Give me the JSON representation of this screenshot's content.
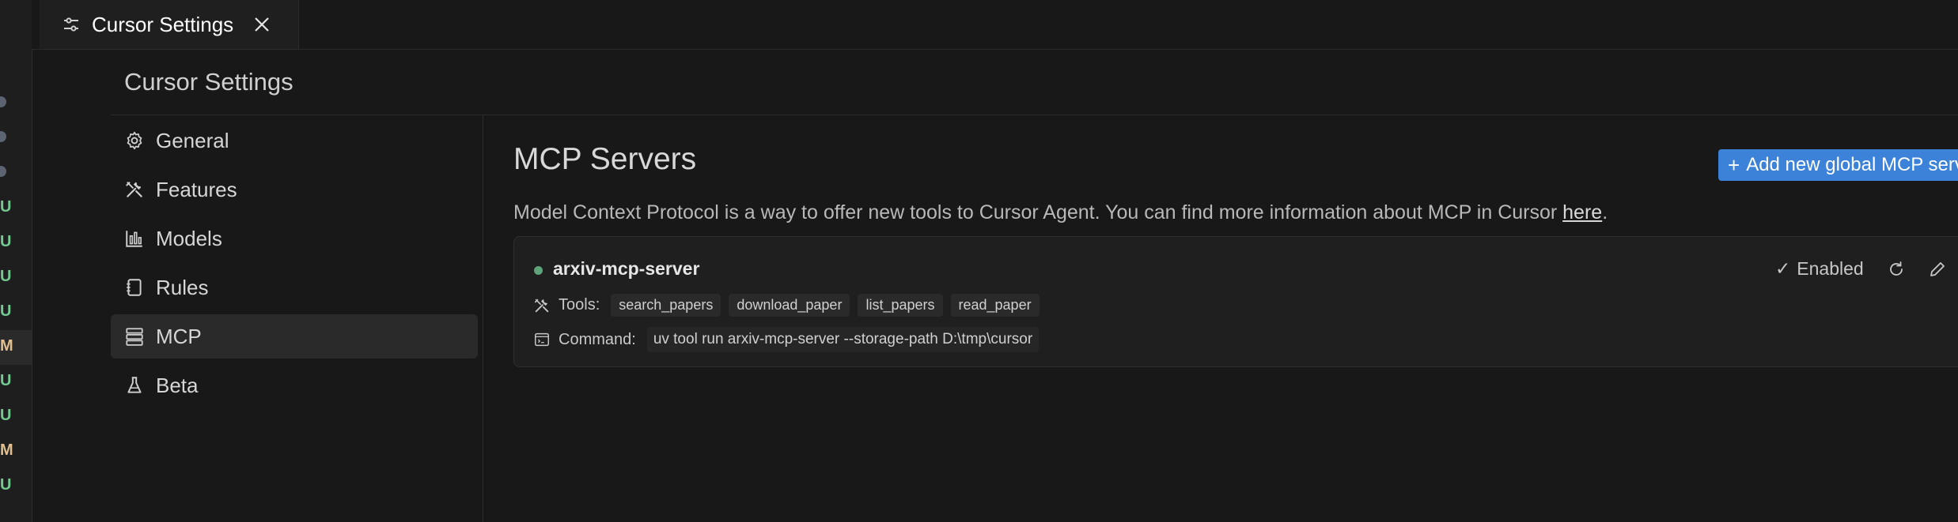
{
  "tab": {
    "label": "Cursor Settings",
    "icon": "settings-sliders-icon"
  },
  "page": {
    "title": "Cursor Settings"
  },
  "sidebar": {
    "items": [
      {
        "label": "General",
        "icon": "gear-icon",
        "active": false
      },
      {
        "label": "Features",
        "icon": "tools-icon",
        "active": false
      },
      {
        "label": "Models",
        "icon": "bar-chart-icon",
        "active": false
      },
      {
        "label": "Rules",
        "icon": "notebook-icon",
        "active": false
      },
      {
        "label": "MCP",
        "icon": "server-icon",
        "active": true
      },
      {
        "label": "Beta",
        "icon": "flask-icon",
        "active": false
      }
    ]
  },
  "gutter": {
    "markers": [
      "U",
      "U",
      "U",
      "U",
      "M",
      "U",
      "U",
      "M",
      "U"
    ],
    "colors": {
      "U": "#73c991",
      "M": "#e2c08d"
    }
  },
  "main": {
    "title": "MCP Servers",
    "add_button": "Add new global MCP server",
    "description_prefix": "Model Context Protocol is a way to offer new tools to Cursor Agent. You can find more information about MCP in Cursor ",
    "description_link": "here",
    "description_suffix": "."
  },
  "server": {
    "name": "arxiv-mcp-server",
    "status_color": "#5ea37a",
    "enabled_label": "Enabled",
    "tools_label": "Tools:",
    "tools": [
      "search_papers",
      "download_paper",
      "list_papers",
      "read_paper"
    ],
    "command_label": "Command:",
    "command": "uv tool run arxiv-mcp-server --storage-path D:\\tmp\\cursor"
  },
  "colors": {
    "accent": "#3b82d8",
    "background": "#181818"
  }
}
